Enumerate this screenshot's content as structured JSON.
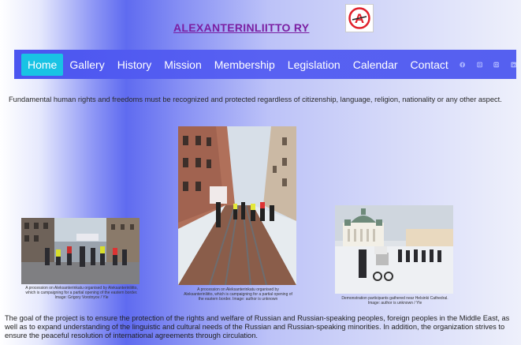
{
  "header": {
    "title": "ALEXANTERINLIITTO RY",
    "logo_letter": "A"
  },
  "nav": {
    "items": [
      {
        "label": "Home",
        "active": true
      },
      {
        "label": "Gallery"
      },
      {
        "label": "History"
      },
      {
        "label": "Mission"
      },
      {
        "label": "Membership"
      },
      {
        "label": "Legislation"
      },
      {
        "label": "Calendar"
      },
      {
        "label": "Contact"
      }
    ],
    "social": [
      "facebook-icon",
      "instagram-icon",
      "youtube-icon",
      "linkedin-icon"
    ]
  },
  "intro_text": "Fundamental human rights and freedoms must be recognized and protected regardless of citizenship, language, religion, nationality or any other aspect.",
  "gallery": [
    {
      "caption": "A procession on Aleksanterinkatu organised by Aleksanterinliitto, which is campaigning for a partial opening of the eastern border. Image: Grigory Vorotnyov / Yle"
    },
    {
      "caption": "A procession on Aleksanterinkatu organised by Aleksanterinliitto, which is campaigning for a partial opening of the eastern border. Image: author is unknown"
    },
    {
      "caption": "Demonstration participants gathered near Helsinki Cathedral. Image: author is unknown / Yle"
    }
  ],
  "goal_text": "The goal of the project is to ensure the protection of the rights and welfare of Russian and Russian-speaking peoples, foreign peoples in the Middle East, as well as to expand understanding of the linguistic and cultural needs of the Russian and Russian-speaking minorities. In addition, the organization strives to ensure the peaceful resolution of international agreements through circulation.",
  "colors": {
    "nav_bg": "#4b55f0",
    "active_bg": "#19c3e4",
    "title": "#7b1fa2",
    "logo_red": "#e0202b"
  }
}
